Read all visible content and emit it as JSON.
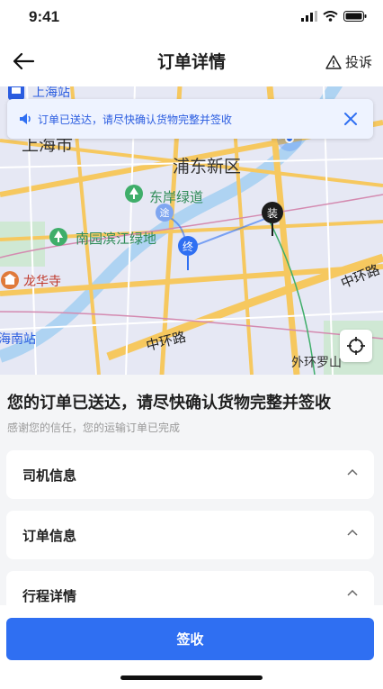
{
  "status_bar": {
    "time": "9:41"
  },
  "nav": {
    "title": "订单详情",
    "complain_label": "投诉"
  },
  "banner": {
    "text": "订单已送达，请尽快确认货物完整并签收"
  },
  "map": {
    "labels": {
      "shanghai_station": "上海站",
      "shanghai_city": "上海市",
      "pudong": "浦东新区",
      "east_bank_greenway": "东岸绿道",
      "nanyuan_greenland": "南园滨江绿地",
      "longhua_temple": "龙华寺",
      "south_station": "海南站",
      "middle_ring_left": "中环路",
      "middle_ring_right": "中环路",
      "outer_ring": "外环罗山"
    },
    "markers": {
      "waypoint": "途",
      "end": "终",
      "load": "装"
    }
  },
  "headline": "您的订单已送达，请尽快确认货物完整并签收",
  "subline": "感谢您的信任，您的运输订单已完成",
  "sections": [
    "司机信息",
    "订单信息",
    "行程详情"
  ],
  "sign_button": "签收",
  "colors": {
    "primary": "#2f6ff2",
    "map_road": "#f6c85f",
    "park": "#3fae6a"
  }
}
